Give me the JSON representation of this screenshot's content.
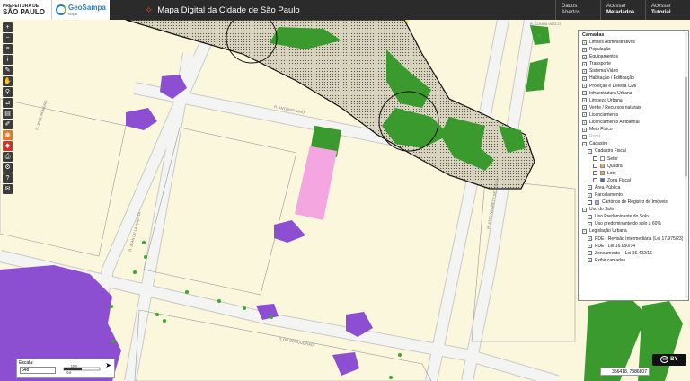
{
  "header": {
    "prefeitura_line1": "PREFEITURA DE",
    "prefeitura_line2": "SÃO PAULO",
    "geosampa_title": "GeoSampa",
    "geosampa_sub": "Mapa",
    "title": "Mapa Digital da Cidade de São Paulo",
    "links": [
      {
        "line1": "Dados",
        "line2": "Abertos",
        "bold": false
      },
      {
        "line1": "Acessar",
        "line2": "Metadados",
        "bold": true
      },
      {
        "line1": "Acessar",
        "line2": "Tutorial",
        "bold": true
      }
    ]
  },
  "map": {
    "streets": [
      {
        "label": "R. ANTONIO MAIO"
      },
      {
        "label": "R. JOSE ROMERO"
      },
      {
        "label": "R. JEAN DE LA HUERTA"
      },
      {
        "label": "R. DO BONGUEIRAO"
      },
      {
        "label": "R. JOSE NEGRETE DE SOUZA"
      },
      {
        "label": "R. CUNHA VASCO"
      }
    ],
    "colors": {
      "land": "#fbf7dc",
      "street": "#f4f4f4",
      "park": "#3a9a2e",
      "urban_zone": "#8d4fd1",
      "lot_pink": "#f3a6e0",
      "buffer_hatch": "#d9d4c0",
      "point": "#3aa92e"
    }
  },
  "toolbar": {
    "tools": [
      {
        "name": "zoom-in-icon",
        "glyph": "+"
      },
      {
        "name": "zoom-out-icon",
        "glyph": "−"
      },
      {
        "name": "layers-icon",
        "glyph": "≡"
      },
      {
        "name": "info-icon",
        "glyph": "i"
      },
      {
        "name": "edit-icon",
        "glyph": "✎"
      },
      {
        "name": "pan-icon",
        "glyph": "✋"
      },
      {
        "name": "search-icon",
        "glyph": "⚲"
      },
      {
        "name": "measure-icon",
        "glyph": "⊿"
      },
      {
        "name": "print-icon",
        "glyph": "▤"
      },
      {
        "name": "draw-icon",
        "glyph": "✐"
      },
      {
        "name": "rss-icon",
        "glyph": "◉"
      },
      {
        "name": "kml-icon",
        "glyph": "◆"
      },
      {
        "name": "printer-icon",
        "glyph": "⎙"
      },
      {
        "name": "settings-icon",
        "glyph": "⚙"
      },
      {
        "name": "help-icon",
        "glyph": "?"
      },
      {
        "name": "email-icon",
        "glyph": "✉"
      }
    ]
  },
  "layers_panel": {
    "title": "Camadas",
    "items": [
      {
        "label": "Limites Administrativos",
        "pm": "+",
        "level": 0
      },
      {
        "label": "População",
        "pm": "+",
        "level": 0
      },
      {
        "label": "Equipamentos",
        "pm": "+",
        "level": 0
      },
      {
        "label": "Transporte",
        "pm": "+",
        "level": 0
      },
      {
        "label": "Sistema Viário",
        "pm": "+",
        "level": 0
      },
      {
        "label": "Habitação / Edificação",
        "pm": "+",
        "level": 0
      },
      {
        "label": "Proteção e Defesa Civil",
        "pm": "+",
        "level": 0
      },
      {
        "label": "Infraestrutura Urbana",
        "pm": "+",
        "level": 0
      },
      {
        "label": "Limpeza Urbana",
        "pm": "+",
        "level": 0
      },
      {
        "label": "Verde / Recursos naturais",
        "pm": "+",
        "level": 0
      },
      {
        "label": "Licenciamento",
        "pm": "+",
        "level": 0
      },
      {
        "label": "Licenciamento Ambiental",
        "pm": "+",
        "level": 0
      },
      {
        "label": "Meio Físico",
        "pm": "+",
        "level": 0
      },
      {
        "label": "Rural",
        "pm": "+",
        "level": 0,
        "muted": true
      },
      {
        "label": "Cadastro",
        "pm": "−",
        "level": 0
      },
      {
        "label": "Cadastro Fiscal",
        "pm": "−",
        "level": 1
      },
      {
        "label": "Setor",
        "level": 2,
        "check": true,
        "swatch": "#ffffff"
      },
      {
        "label": "Quadra",
        "level": 2,
        "check": true,
        "swatch": "#f1b32a"
      },
      {
        "label": "Lote",
        "level": 2,
        "check": true,
        "swatch": "#f1b32a"
      },
      {
        "label": "Zona Fiscal",
        "level": 2,
        "check": true,
        "swatch": "#3a6fd0"
      },
      {
        "label": "Área Pública",
        "pm": "+",
        "level": 1
      },
      {
        "label": "Parcelamento",
        "pm": "+",
        "level": 1
      },
      {
        "label": "Cartórios de Registro de Imóveis",
        "level": 1,
        "check": true,
        "swatch": "#8fb0ff"
      },
      {
        "label": "Uso do Solo",
        "pm": "−",
        "level": 0
      },
      {
        "label": "Uso Predominante do Solo",
        "pm": "+",
        "level": 1
      },
      {
        "label": "Uso predominante do solo ≥ 60%",
        "pm": "+",
        "level": 1
      },
      {
        "label": "Legislação Urbana",
        "pm": "−",
        "level": 0
      },
      {
        "label": "PDE - Revisão Intermediária (Lei 17.975/23)",
        "pm": "+",
        "level": 1
      },
      {
        "label": "PDE - Lei 16.050/14",
        "pm": "+",
        "level": 1
      },
      {
        "label": "Zoneamento – Lei 16.402/16",
        "pm": "+",
        "level": 1
      },
      {
        "label": "Exibir camadas",
        "pm": "+",
        "level": 1
      }
    ]
  },
  "scale": {
    "label": "Escala:",
    "value": "648",
    "bar_top": "10 m",
    "bar_bottom": "20 ft",
    "north": "N"
  },
  "coords": {
    "text": "356418, 7386807"
  },
  "license": {
    "label": "cc",
    "text": "BY"
  }
}
